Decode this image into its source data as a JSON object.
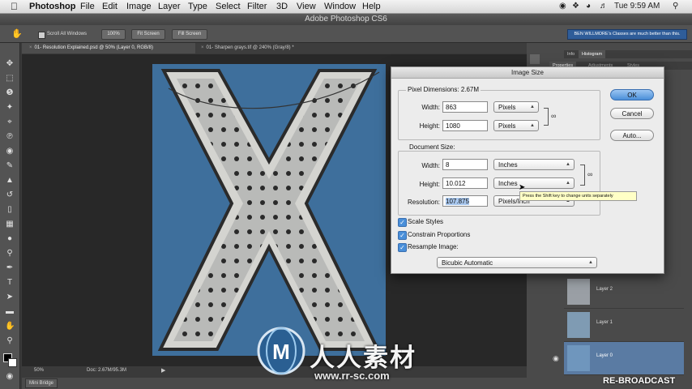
{
  "menubar": {
    "app": "Photoshop",
    "items": [
      "File",
      "Edit",
      "Image",
      "Layer",
      "Type",
      "Select",
      "Filter",
      "3D",
      "View",
      "Window",
      "Help"
    ],
    "clock": "Tue 9:59 AM"
  },
  "window": {
    "title": "Adobe Photoshop CS6"
  },
  "options_bar": {
    "scroll_all_windows": "Scroll All Windows",
    "btn_100": "100%",
    "btn_fit": "Fit Screen",
    "btn_fill": "Fill Screen",
    "promo": "BEN WILLMORE's Classes are much better than this."
  },
  "doc_tabs": [
    {
      "label": "01- Resolution Explained.psd @ 50% (Layer 0, RGB/8)"
    },
    {
      "label": "01- Sharpen grays.tif @ 240% (Gray/8) *"
    }
  ],
  "status": {
    "zoom": "50%",
    "doc": "Doc: 2.67M/95.3M",
    "mini_bridge": "Mini Bridge"
  },
  "panels": {
    "tabs": [
      "Info",
      "Histogram"
    ],
    "subtabs": [
      "Properties",
      "Adjustments",
      "Styles"
    ],
    "layers": [
      {
        "name": "Layer 2"
      },
      {
        "name": "Layer 1"
      },
      {
        "name": "Layer 0"
      }
    ]
  },
  "dialog": {
    "title": "Image Size",
    "pixel_dimensions_label": "Pixel Dimensions:",
    "pixel_dimensions_value": "2.67M",
    "width_label": "Width:",
    "height_label": "Height:",
    "px_width": "863",
    "px_height": "1080",
    "px_width_unit": "Pixels",
    "px_height_unit": "Pixels",
    "document_size_label": "Document Size:",
    "doc_width": "8",
    "doc_height": "10.012",
    "doc_width_unit": "Inches",
    "doc_height_unit": "Inches",
    "resolution_label": "Resolution:",
    "resolution": "107.875",
    "resolution_unit": "Pixels/Inch",
    "scale_styles": "Scale Styles",
    "constrain_proportions": "Constrain Proportions",
    "resample_image": "Resample Image:",
    "resample_method": "Bicubic Automatic",
    "ok": "OK",
    "cancel": "Cancel",
    "auto": "Auto...",
    "tooltip": "Press the Shift key to change units separately"
  },
  "watermark": {
    "text": "人人素材",
    "url": "www.rr-sc.com",
    "logo_letter": "M"
  },
  "rebroadcast": "RE-BROADCAST",
  "colors": {
    "photo_blue": "#3e6f9c",
    "ok_blue": "#4a8fd9",
    "ps_panel": "#535353"
  }
}
